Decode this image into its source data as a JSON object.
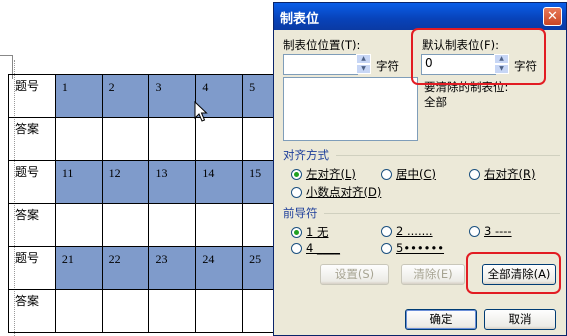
{
  "document": {
    "rows": [
      {
        "label": "题号",
        "cells": [
          "1",
          "2",
          "3",
          "4",
          "5"
        ]
      },
      {
        "label": "答案",
        "cells": [
          "",
          "",
          "",
          "",
          ""
        ]
      },
      {
        "label": "题号",
        "cells": [
          "11",
          "12",
          "13",
          "14",
          "15"
        ]
      },
      {
        "label": "答案",
        "cells": [
          "",
          "",
          "",
          "",
          ""
        ]
      },
      {
        "label": "题号",
        "cells": [
          "21",
          "22",
          "23",
          "24",
          "25"
        ]
      },
      {
        "label": "答案",
        "cells": [
          "",
          "",
          "",
          "",
          ""
        ]
      }
    ]
  },
  "dialog": {
    "title": "制表位",
    "tab_position_label": "制表位位置(T):",
    "tab_position_value": "",
    "unit1": "字符",
    "default_tab_label": "默认制表位(F):",
    "default_tab_value": "0",
    "unit2": "字符",
    "to_clear_label": "要清除的制表位:",
    "to_clear_value": "全部",
    "alignment": {
      "heading": "对齐方式",
      "options": [
        "左对齐(L)",
        "居中(C)",
        "右对齐(R)",
        "小数点对齐(D)"
      ],
      "selected": "左对齐(L)"
    },
    "leader": {
      "heading": "前导符",
      "options": [
        "1 无",
        "2 .......",
        "3 ----",
        "4 ____",
        "5••••••"
      ],
      "selected": "1 无"
    },
    "buttons": {
      "set": "设置(S)",
      "clear": "清除(E)",
      "clear_all": "全部清除(A)",
      "ok": "确定",
      "cancel": "取消"
    }
  },
  "colors": {
    "highlight": "#7f9bcb",
    "title_bar": "#0a5ee8",
    "callout": "#e21c23"
  }
}
